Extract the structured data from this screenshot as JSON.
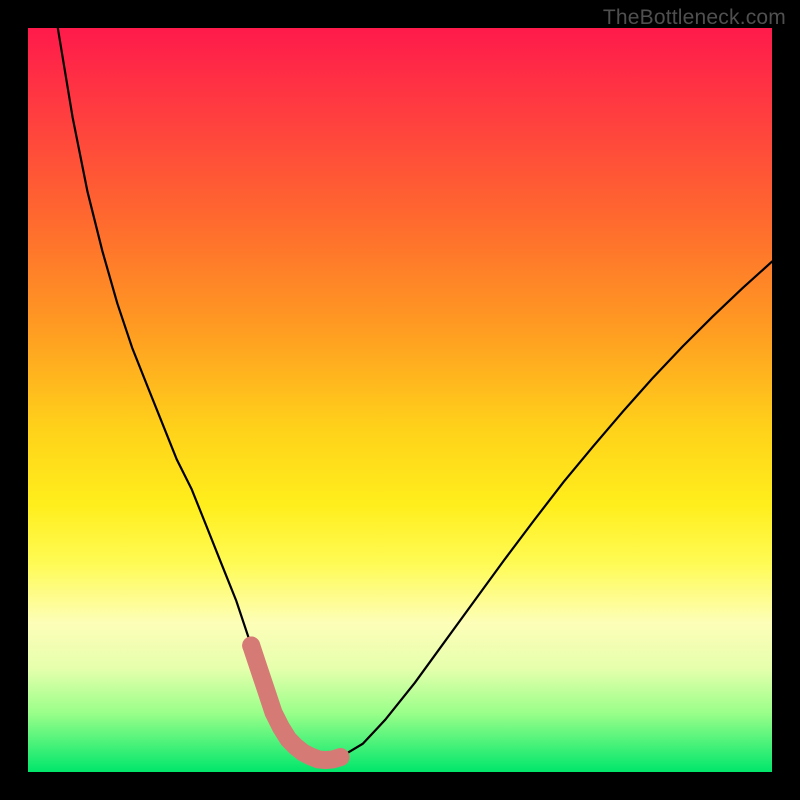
{
  "watermark": "TheBottleneck.com",
  "colors": {
    "frame": "#000000",
    "gradient_top": "#ff1a4b",
    "gradient_bottom": "#00e66b",
    "curve_stroke": "#000000",
    "marker_stroke": "#d67a76",
    "marker_fill": "none"
  },
  "chart_data": {
    "type": "line",
    "title": "",
    "xlabel": "",
    "ylabel": "",
    "xlim": [
      0,
      100
    ],
    "ylim": [
      0,
      100
    ],
    "grid": false,
    "legend": false,
    "series": [
      {
        "name": "bottleneck-curve",
        "x": [
          4,
          6,
          8,
          10,
          12,
          14,
          16,
          18,
          20,
          22,
          24,
          26,
          28,
          30,
          31,
          32,
          33,
          34,
          35,
          36,
          37,
          38,
          39,
          40,
          42,
          45,
          48,
          52,
          56,
          60,
          64,
          68,
          72,
          76,
          80,
          84,
          88,
          92,
          96,
          100
        ],
        "values": [
          100,
          88,
          78,
          70,
          63,
          57,
          52,
          47,
          42,
          38,
          33,
          28,
          23,
          17,
          14,
          11,
          8,
          6,
          4.4,
          3.4,
          2.6,
          2.1,
          1.7,
          1.6,
          2.0,
          3.8,
          7.0,
          12.0,
          17.5,
          23.0,
          28.5,
          33.8,
          39.0,
          43.8,
          48.5,
          53.0,
          57.2,
          61.2,
          65.0,
          68.6
        ]
      }
    ],
    "markers": {
      "name": "highlighted-range",
      "x": [
        30,
        31,
        32,
        33,
        34,
        35,
        36,
        37,
        38,
        39,
        40,
        41,
        42
      ],
      "values": [
        17,
        14,
        11,
        8,
        6,
        4.4,
        3.4,
        2.6,
        2.1,
        1.7,
        1.6,
        1.7,
        2.0
      ]
    }
  }
}
